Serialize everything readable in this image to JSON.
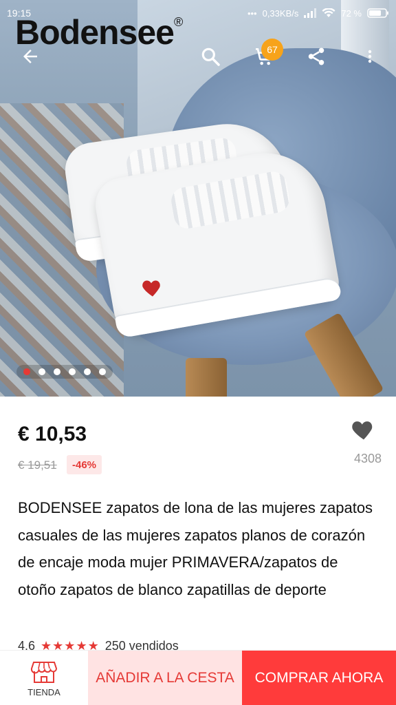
{
  "status_bar": {
    "time": "19:15",
    "network_speed": "0,33KB/s",
    "battery": "72 %"
  },
  "brand": {
    "name": "Bodensee",
    "mark": "®"
  },
  "toolbar": {
    "cart_count": "67",
    "icons": [
      "back-arrow-icon",
      "search-icon",
      "cart-icon",
      "share-icon",
      "more-vert-icon"
    ]
  },
  "gallery": {
    "image_count": 6,
    "active_index": 0
  },
  "product": {
    "price": "€ 10,53",
    "old_price": "€ 19,51",
    "discount": "-46%",
    "favorites": "4308",
    "title": "BODENSEE zapatos de lona de las mujeres zapatos casuales de las mujeres zapatos planos de corazón de encaje moda mujer PRIMAVERA/zapatos de otoño zapatos de blanco zapatillas de deporte",
    "rating": "4.6",
    "stars": "★★★★★",
    "sold": "250 vendidos"
  },
  "bottom_bar": {
    "store_label": "TIENDA",
    "add_to_cart": "AÑADIR A LA CESTA",
    "buy_now": "COMPRAR AHORA"
  },
  "colors": {
    "accent": "#e53935",
    "buy_now_bg": "#ff3b3b",
    "add_cart_bg": "#ffe3e3",
    "cart_badge": "#f7a31a"
  }
}
